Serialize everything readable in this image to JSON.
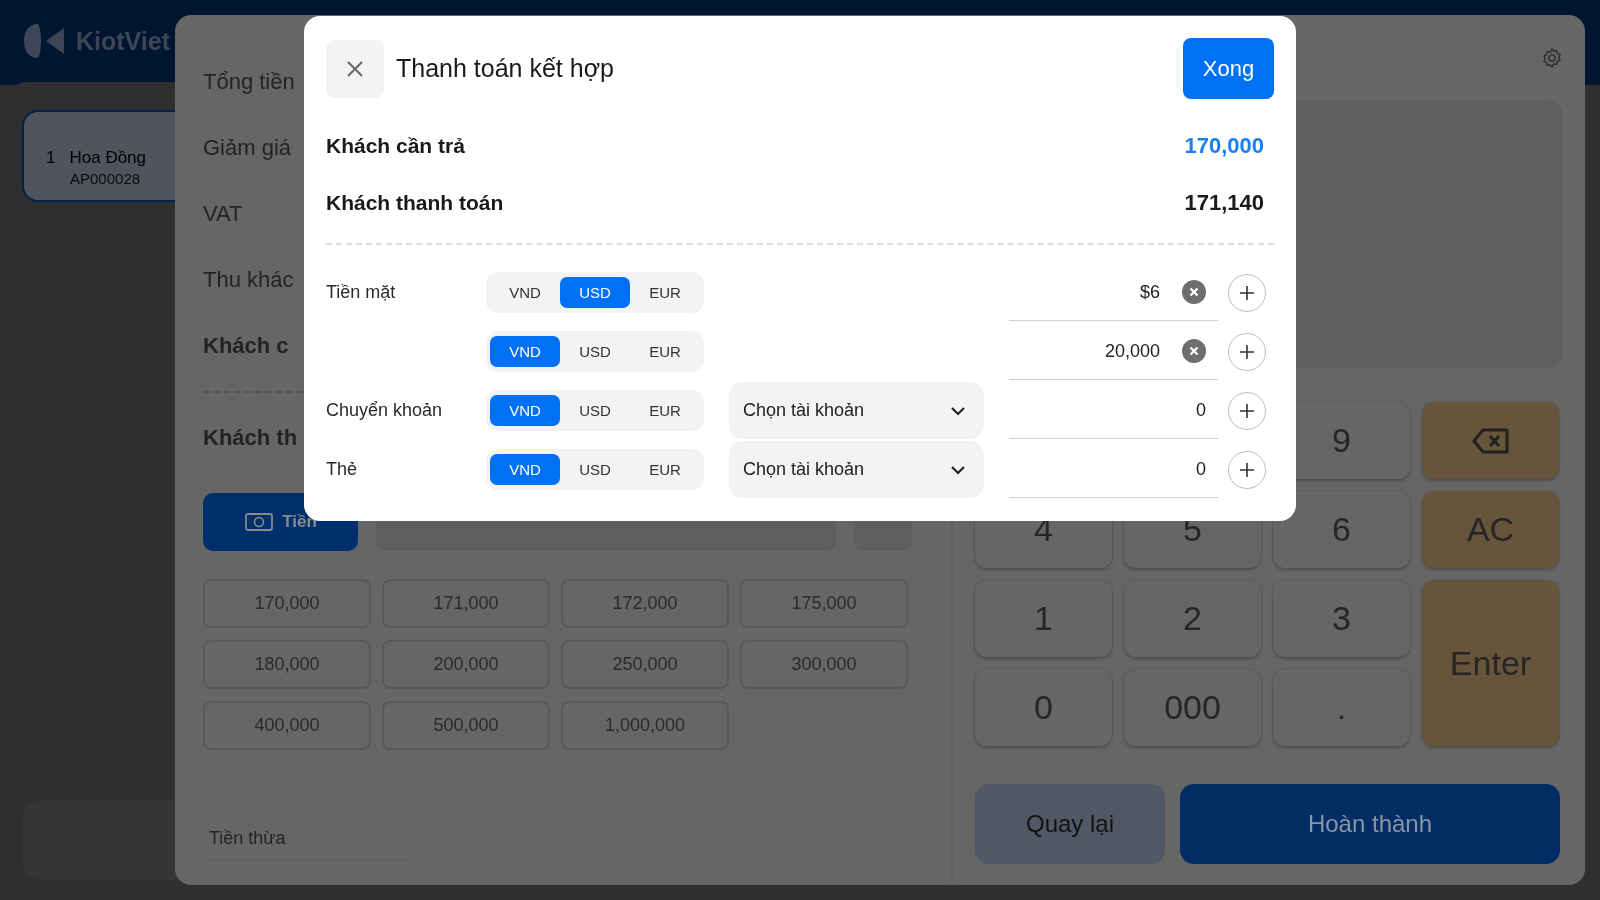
{
  "app": {
    "logo": "KiotViet",
    "order_items": [
      {
        "index": "1",
        "name": "Hoa Đồng",
        "code": "AP000028"
      }
    ]
  },
  "payment_panel": {
    "summary": [
      {
        "label": "Tổng tiền",
        "kind": "normal"
      },
      {
        "label": "Giảm giá",
        "kind": "normal"
      },
      {
        "label": "VAT",
        "kind": "normal"
      },
      {
        "label": "Thu khác",
        "kind": "normal"
      },
      {
        "label": "Khách c",
        "kind": "bold"
      },
      {
        "label": "Khách th",
        "kind": "bold"
      }
    ],
    "tabs": [
      {
        "label": "Tiền",
        "selected": true
      },
      {
        "selected": false
      },
      {
        "selected": false
      }
    ],
    "quick_amounts": [
      "170,000",
      "171,000",
      "172,000",
      "175,000",
      "180,000",
      "200,000",
      "250,000",
      "300,000",
      "400,000",
      "500,000",
      "1,000,000"
    ],
    "change_label": "Tiền thừa",
    "keypad": [
      {
        "label": "9",
        "kind": "digit"
      },
      {
        "kind": "backspace"
      },
      {
        "label": "4",
        "kind": "digit"
      },
      {
        "label": "5",
        "kind": "digit"
      },
      {
        "label": "6",
        "kind": "digit"
      },
      {
        "label": "AC",
        "kind": "action"
      },
      {
        "label": "1",
        "kind": "digit"
      },
      {
        "label": "2",
        "kind": "digit"
      },
      {
        "label": "3",
        "kind": "digit"
      },
      {
        "label": "Enter",
        "kind": "enter"
      },
      {
        "label": "0",
        "kind": "digit"
      },
      {
        "label": "000",
        "kind": "digit"
      },
      {
        "label": ".",
        "kind": "digit"
      }
    ],
    "back_button": "Quay lại",
    "finish_button": "Hoàn thành"
  },
  "dialog": {
    "title": "Thanh toán kết hợp",
    "done_button": "Xong",
    "totals": [
      {
        "label": "Khách cần trả",
        "value": "170,000",
        "kind": "due"
      },
      {
        "label": "Khách thanh toán",
        "value": "171,140",
        "kind": "paid"
      }
    ],
    "payments": [
      {
        "method": "Tiền mặt",
        "currencies": [
          {
            "code": "VND",
            "selected": false
          },
          {
            "code": "USD",
            "selected": true
          },
          {
            "code": "EUR",
            "selected": false
          }
        ],
        "amount": "$6",
        "clearable": true
      },
      {
        "currencies": [
          {
            "code": "VND",
            "selected": true
          },
          {
            "code": "USD",
            "selected": false
          },
          {
            "code": "EUR",
            "selected": false
          }
        ],
        "amount": "20,000",
        "clearable": true
      },
      {
        "method": "Chuyển khoản",
        "currencies": [
          {
            "code": "VND",
            "selected": true
          },
          {
            "code": "USD",
            "selected": false
          },
          {
            "code": "EUR",
            "selected": false
          }
        ],
        "account": "Chọn tài khoản",
        "amount": "0",
        "clearable": false
      },
      {
        "method": "Thẻ",
        "currencies": [
          {
            "code": "VND",
            "selected": true
          },
          {
            "code": "USD",
            "selected": false
          },
          {
            "code": "EUR",
            "selected": false
          }
        ],
        "account": "Chọn tài khoản",
        "amount": "0",
        "clearable": false
      }
    ]
  }
}
